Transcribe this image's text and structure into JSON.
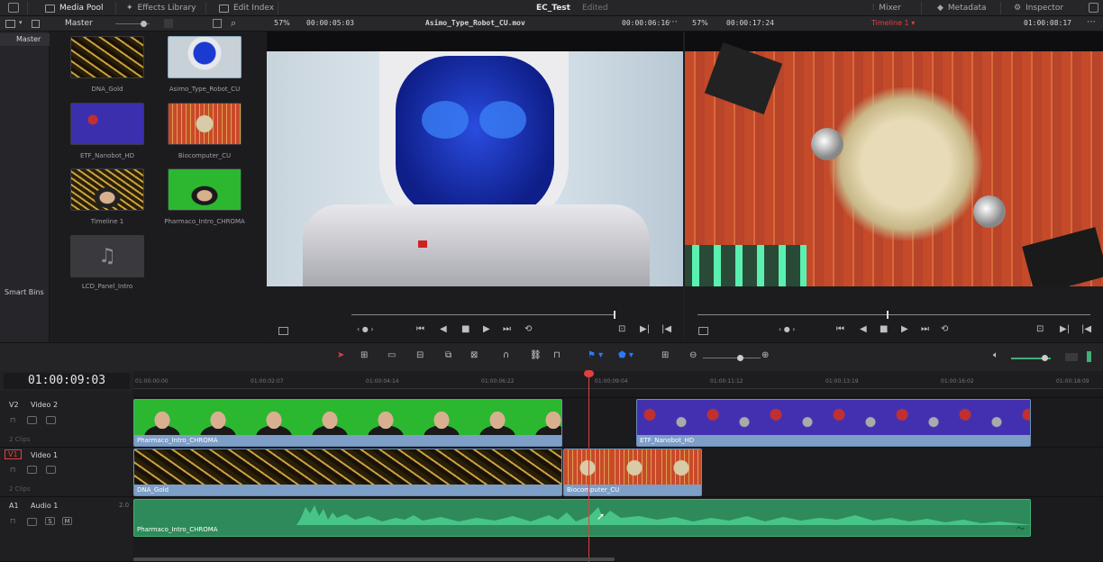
{
  "topbar": {
    "media_pool": "Media Pool",
    "effects_library": "Effects Library",
    "edit_index": "Edit Index",
    "project": "EC_Test",
    "status": "Edited",
    "mixer": "Mixer",
    "metadata": "Metadata",
    "inspector": "Inspector"
  },
  "pool": {
    "bin": "Master",
    "sidebar_master": "Master",
    "smart_bins": "Smart Bins",
    "items": [
      "DNA_Gold",
      "Asimo_Type_Robot_CU",
      "ETF_Nanobot_HD",
      "Biocomputer_CU",
      "Timeline 1",
      "Pharmaco_Intro_CHROMA",
      "LCD_Panel_Intro"
    ]
  },
  "source": {
    "zoom": "57%",
    "timecode": "00:00:05:03",
    "clip": "Asimo_Type_Robot_CU.mov",
    "duration": "00:00:06:16"
  },
  "program": {
    "zoom": "57%",
    "timecode": "00:00:17:24",
    "timeline": "Timeline 1",
    "position": "01:00:08:17"
  },
  "timeline": {
    "timecode": "01:00:09:03",
    "ticks": [
      "01:00:00:00",
      "01:00:02:07",
      "01:00:04:14",
      "01:00:06:22",
      "01:00:09:04",
      "01:00:11:12",
      "01:00:13:19",
      "01:00:16:02",
      "01:00:18:09"
    ]
  },
  "tracks": {
    "v2": {
      "id": "V2",
      "name": "Video 2",
      "count": "2 Clips"
    },
    "v1": {
      "id": "V1",
      "name": "Video 1",
      "count": "2 Clips"
    },
    "a1": {
      "id": "A1",
      "name": "Audio 1",
      "channels": "2.0",
      "s": "S",
      "m": "M"
    }
  },
  "clips": {
    "v2a": "Pharmaco_Intro_CHROMA",
    "v2b": "ETF_Nanobot_HD",
    "v1a": "DNA_Gold",
    "v1b": "Biocomputer_CU",
    "a1": "Pharmaco_Intro_CHROMA"
  },
  "colors": {
    "accent_red": "#e04040",
    "clip_blue": "#7d9ec7",
    "audio_green": "#2e8a5a"
  }
}
